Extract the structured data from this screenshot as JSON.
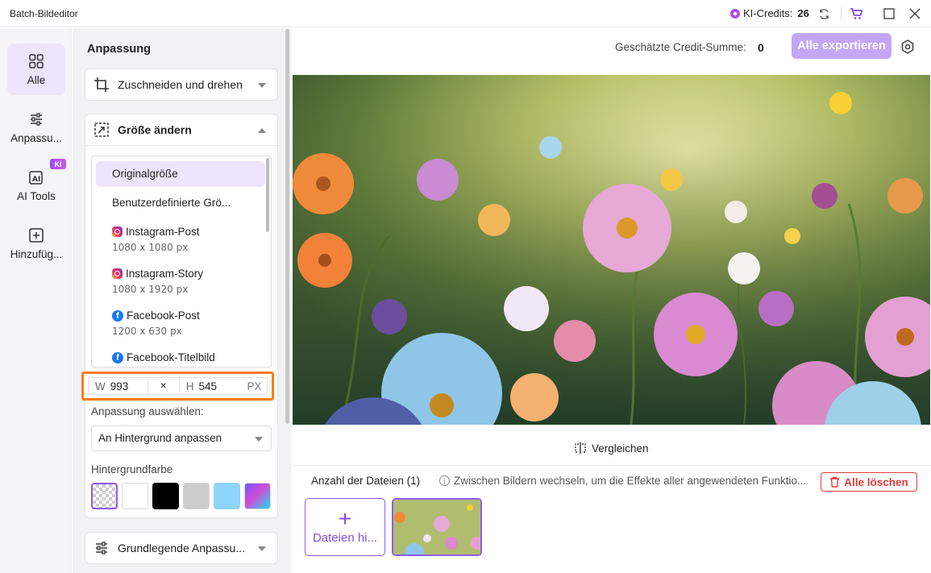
{
  "app": {
    "title": "Batch-Bildeditor"
  },
  "titlebar": {
    "credits_label": "KI-Credits:",
    "credits_value": "26",
    "icons": [
      "refresh-icon",
      "cart-icon",
      "maximize-icon",
      "close-icon"
    ]
  },
  "nav": {
    "items": [
      {
        "label": "Alle",
        "icon": "grid-icon",
        "active": true
      },
      {
        "label": "Anpassu...",
        "icon": "sliders-icon",
        "active": false
      },
      {
        "label": "AI Tools",
        "icon": "ai-icon",
        "active": false,
        "badge": "KI"
      },
      {
        "label": "Hinzufüg...",
        "icon": "plus-square-icon",
        "active": false
      }
    ]
  },
  "panel": {
    "title": "Anpassung",
    "crop_section": "Zuschneiden und drehen",
    "resize_section": "Größe ändern",
    "sizes": [
      {
        "name": "Originalgröße",
        "dims": "",
        "icon": ""
      },
      {
        "name": "Benutzerdefinierte Grö...",
        "dims": "",
        "icon": ""
      },
      {
        "name": "Instagram-Post",
        "dims": "1080 x 1080 px",
        "icon": "instagram-icon"
      },
      {
        "name": "Instagram-Story",
        "dims": "1080 x 1920 px",
        "icon": "instagram-icon"
      },
      {
        "name": "Facebook-Post",
        "dims": "1200 x 630 px",
        "icon": "facebook-icon"
      },
      {
        "name": "Facebook-Titelbild",
        "dims": "",
        "icon": "facebook-icon"
      }
    ],
    "width_label": "W",
    "width_value": "993",
    "times": "×",
    "height_label": "H",
    "height_value": "545",
    "unit": "PX",
    "fit_label": "Anpassung auswählen:",
    "fit_value": "An Hintergrund anpassen",
    "bg_label": "Hintergrundfarbe",
    "swatches": [
      "transparent",
      "#ffffff",
      "#000000",
      "#cccccc",
      "#8ed4fb",
      "gradient"
    ],
    "basic_section": "Grundlegende Anpassu..."
  },
  "main": {
    "credit_sum_label": "Geschätzte Credit-Summe:",
    "credit_sum_value": "0",
    "export_label": "Alle exportieren",
    "compare_label": "Vergleichen",
    "files_count": "Anzahl der Dateien (1)",
    "hint": "Zwischen Bildern wechseln, um die Effekte aller angewendeten Funktio...",
    "clear_label": "Alle löschen",
    "add_label": "Dateien hi..."
  },
  "colors": {
    "accent": "#8a5cf6",
    "export_bg": "#c3a6f7",
    "highlight": "#ff7a1a",
    "danger": "#e53935"
  }
}
